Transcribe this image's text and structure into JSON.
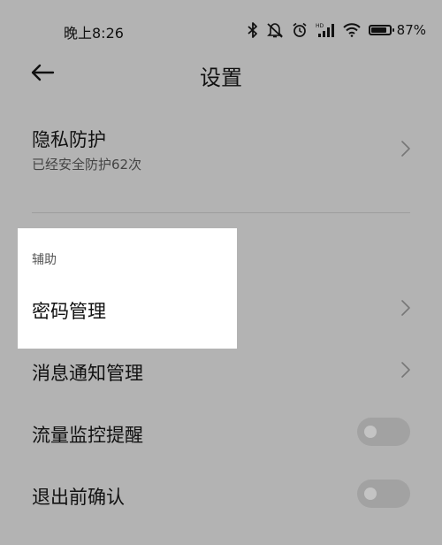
{
  "status_bar": {
    "time": "晚上8:26",
    "battery_percent": "87%",
    "battery_level": 0.87,
    "icons": [
      "bluetooth-icon",
      "mute-icon",
      "alarm-icon",
      "hd-signal-icon",
      "wifi-icon",
      "battery-icon"
    ]
  },
  "header": {
    "back_icon": "arrow-left-icon",
    "title": "设置"
  },
  "privacy": {
    "title": "隐私防护",
    "subtitle": "已经安全防护62次"
  },
  "section": {
    "label": "辅助"
  },
  "items": {
    "password": "密码管理",
    "notifications": "消息通知管理",
    "traffic_reminder": "流量监控提醒",
    "exit_confirm": "退出前确认"
  },
  "toggles": {
    "traffic_reminder_on": false,
    "exit_confirm_on": false
  },
  "colors": {
    "overlay_background": "#b3b3b3",
    "highlight_background": "#ffffff"
  }
}
